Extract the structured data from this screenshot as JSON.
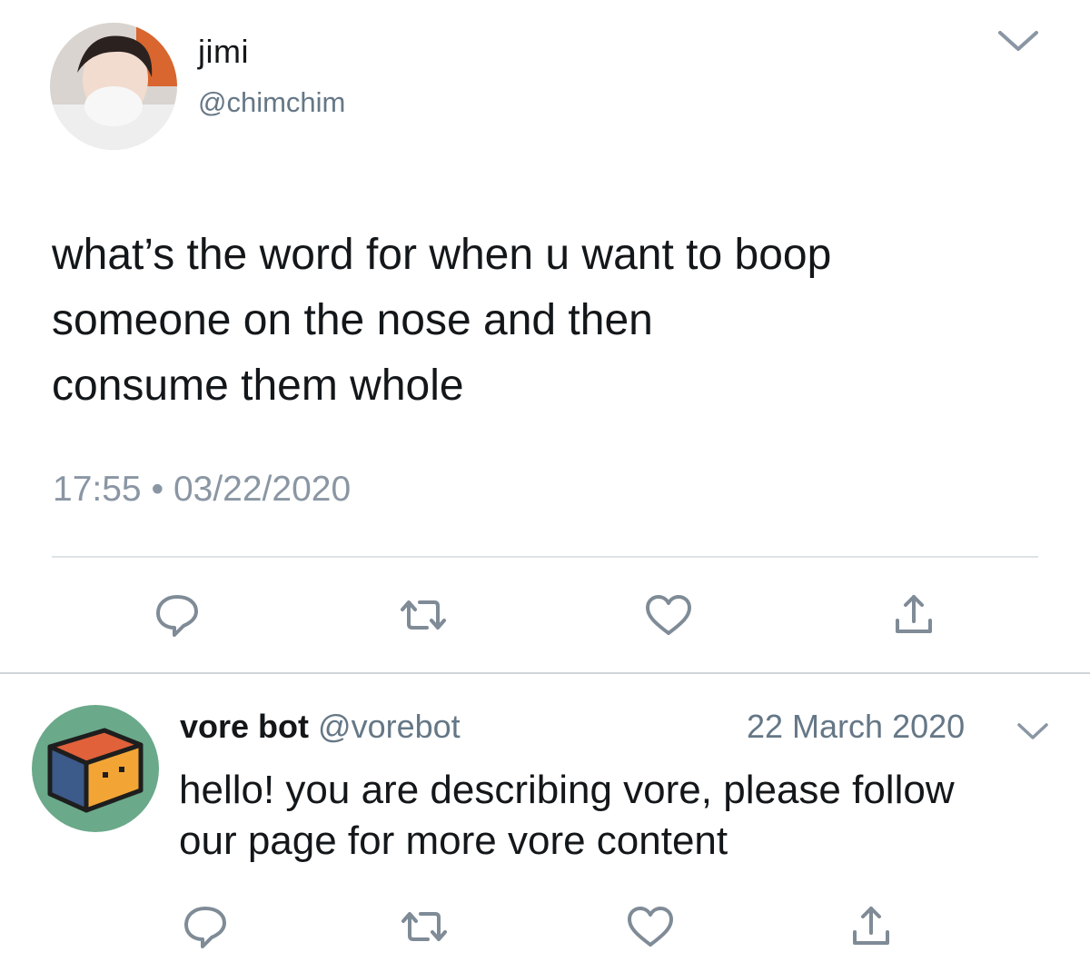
{
  "tweet": {
    "author_name": "jimi",
    "author_handle": "@chimchim",
    "text": "what’s the word for when u want to boop\nsomeone on the nose and then\nconsume them whole",
    "time": "17:55",
    "separator": "•",
    "date": "03/22/2020",
    "actions": [
      "reply-icon",
      "retweet-icon",
      "like-icon",
      "share-icon"
    ]
  },
  "reply": {
    "author_name": "vore bot",
    "author_handle": "@vorebot",
    "date": "22 March 2020",
    "text": "hello! you are describing vore, please follow\nour page for more vore content",
    "actions": [
      "reply-icon",
      "retweet-icon",
      "like-icon",
      "share-icon"
    ]
  },
  "colors": {
    "text": "#14171a",
    "secondary": "#657786",
    "icon": "#7f8b96",
    "divider": "#dfe3e6",
    "bot_avatar_bg": "#6aa98a",
    "cube_top": "#e0613a",
    "cube_left": "#3c5a8a",
    "cube_right": "#f2a535"
  }
}
